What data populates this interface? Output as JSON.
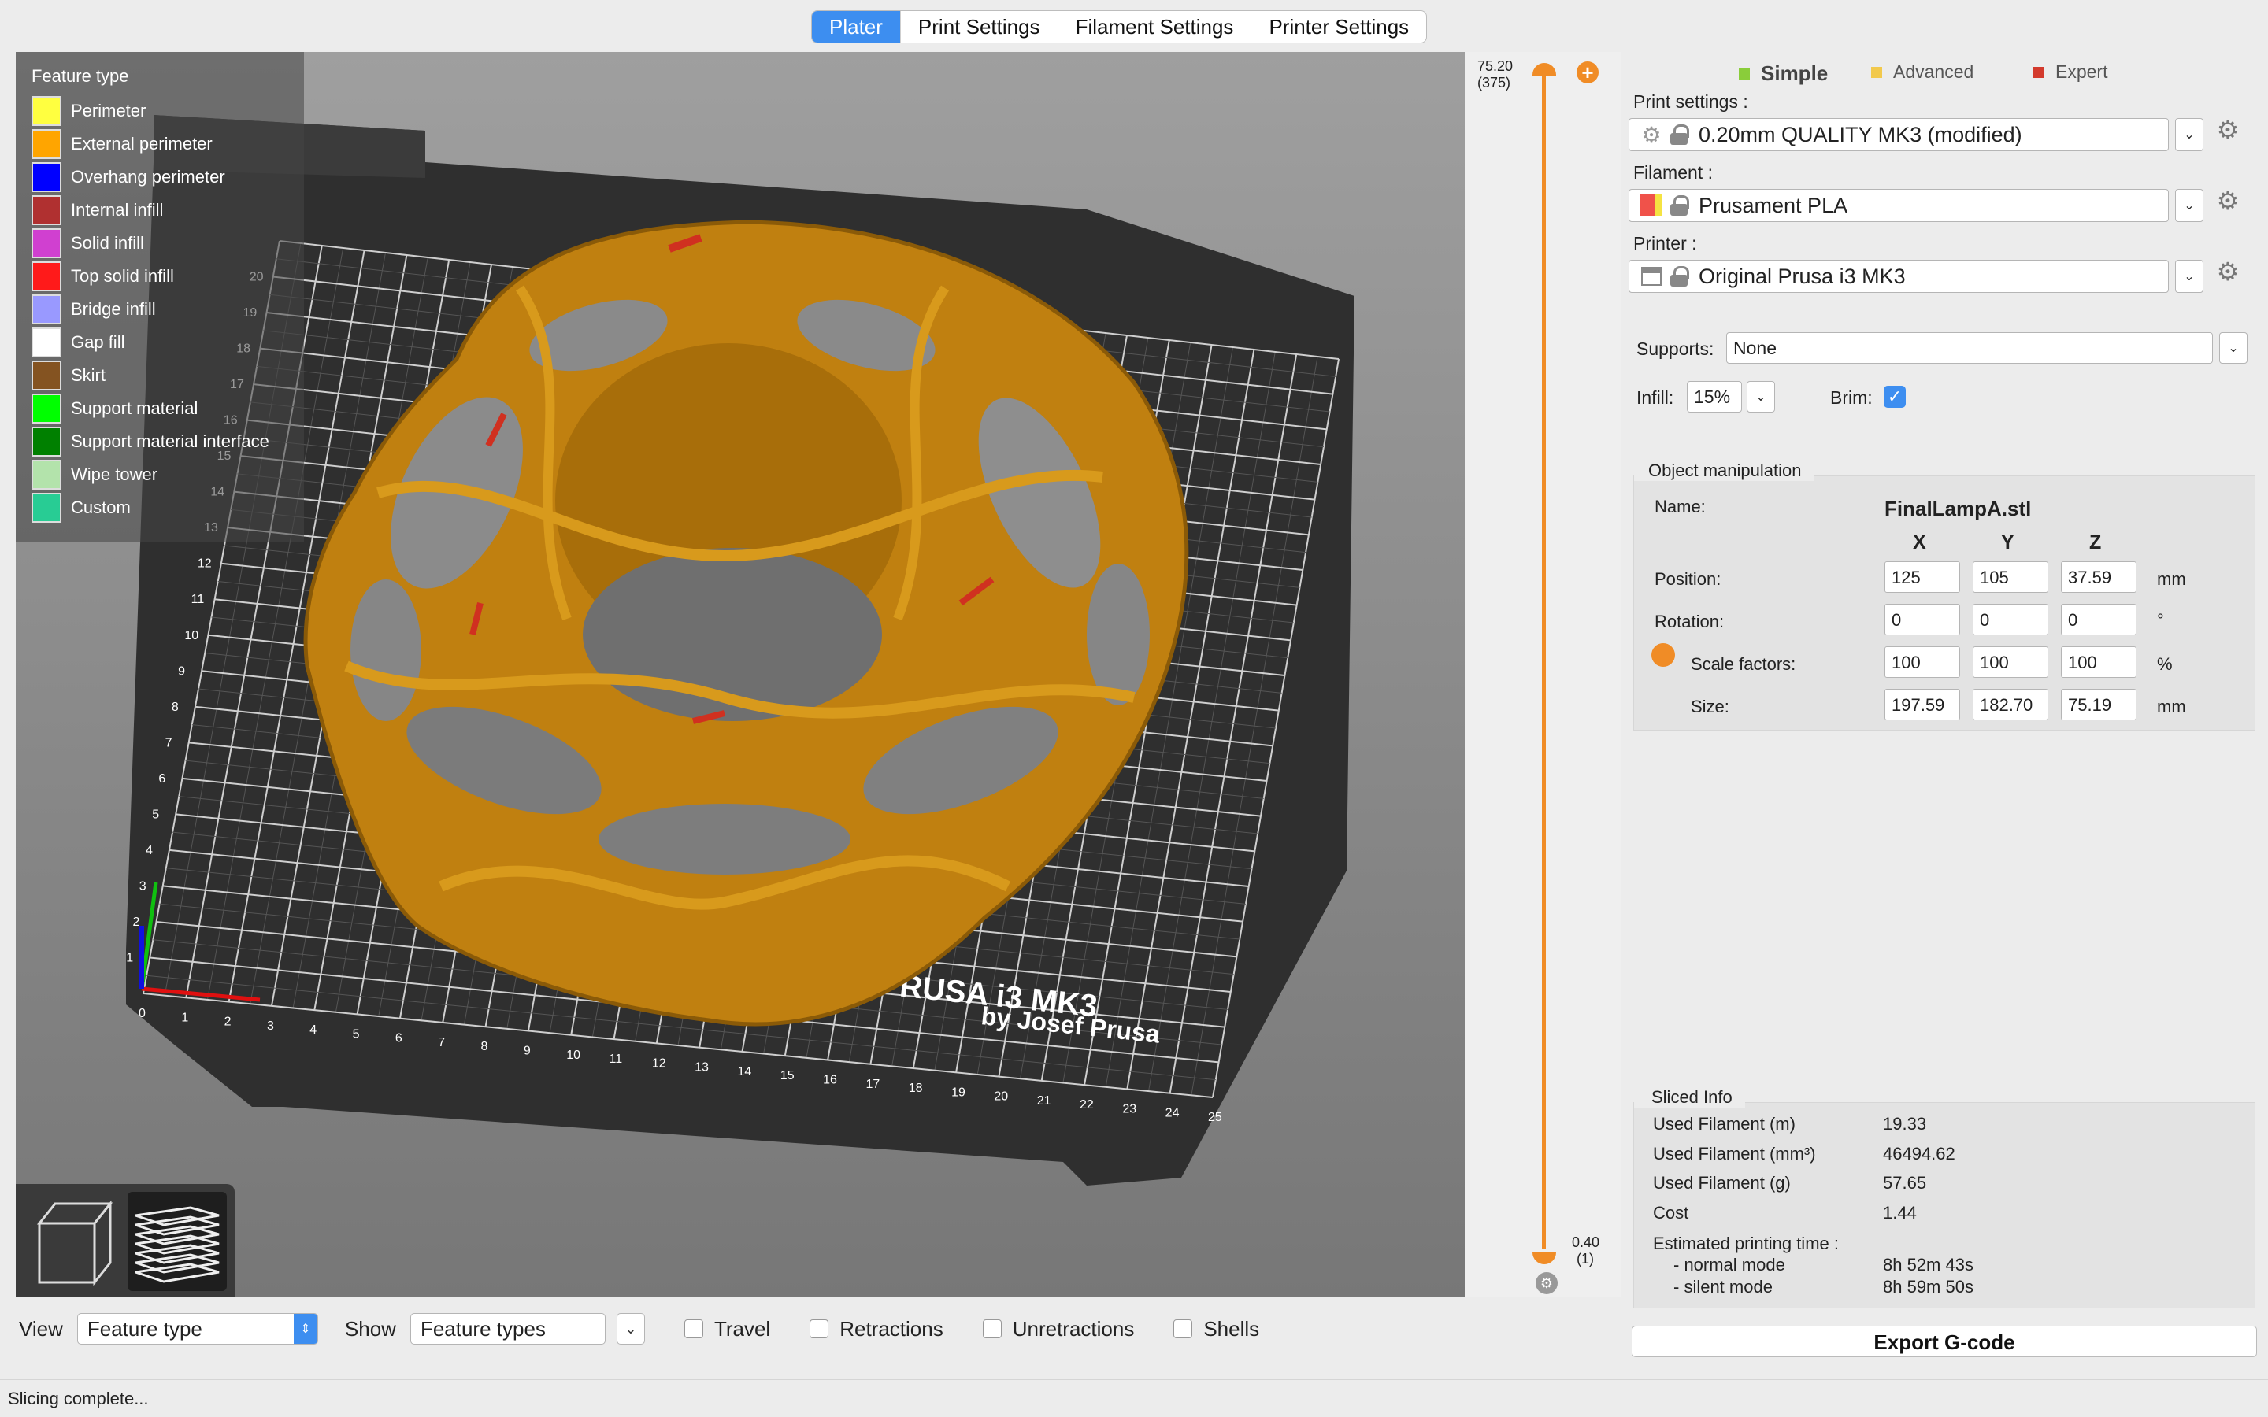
{
  "tabs": [
    "Plater",
    "Print Settings",
    "Filament Settings",
    "Printer Settings"
  ],
  "legend": {
    "title": "Feature type",
    "items": [
      {
        "label": "Perimeter",
        "color": "#FFFF40"
      },
      {
        "label": "External perimeter",
        "color": "#FFA500"
      },
      {
        "label": "Overhang perimeter",
        "color": "#0000FF"
      },
      {
        "label": "Internal infill",
        "color": "#B03030"
      },
      {
        "label": "Solid infill",
        "color": "#D040D0"
      },
      {
        "label": "Top solid infill",
        "color": "#FF1A1A"
      },
      {
        "label": "Bridge infill",
        "color": "#9999FF"
      },
      {
        "label": "Gap fill",
        "color": "#FFFFFF"
      },
      {
        "label": "Skirt",
        "color": "#845321"
      },
      {
        "label": "Support material",
        "color": "#00FF00"
      },
      {
        "label": "Support material interface",
        "color": "#008000"
      },
      {
        "label": "Wipe tower",
        "color": "#B3E3AB"
      },
      {
        "label": "Custom",
        "color": "#28CC94"
      }
    ]
  },
  "bed": {
    "ticks_x": [
      "0",
      "1",
      "2",
      "3",
      "4",
      "5",
      "6",
      "7",
      "8",
      "9",
      "10",
      "11",
      "12",
      "13",
      "14",
      "15",
      "16",
      "17",
      "18",
      "19",
      "20",
      "21",
      "22",
      "23",
      "24",
      "25"
    ],
    "ticks_y": [
      "1",
      "2",
      "3",
      "4",
      "5",
      "6",
      "7",
      "8",
      "9",
      "10",
      "11",
      "12",
      "13",
      "14",
      "15",
      "16",
      "17",
      "18",
      "19",
      "20"
    ],
    "logo_line1": "ORIGINAL PRUSA i3 MK3",
    "logo_line2": "by Josef Prusa"
  },
  "slider": {
    "top_value": "75.20",
    "top_layer": "(375)",
    "bottom_value": "0.40",
    "bottom_layer": "(1)",
    "top_position": 1.0,
    "bottom_position": 0.0
  },
  "bottom": {
    "view_label": "View",
    "view_value": "Feature type",
    "show_label": "Show",
    "show_value": "Feature types",
    "checkboxes": [
      "Travel",
      "Retractions",
      "Unretractions",
      "Shells"
    ]
  },
  "status": "Slicing complete...",
  "panel": {
    "modes": [
      {
        "label": "Simple",
        "color": "#8ACD3A",
        "active": true
      },
      {
        "label": "Advanced",
        "color": "#F2C94C",
        "active": false
      },
      {
        "label": "Expert",
        "color": "#D33A2C",
        "active": false
      }
    ],
    "print_settings_label": "Print settings :",
    "print_settings_value": "0.20mm QUALITY MK3 (modified)",
    "filament_label": "Filament :",
    "filament_value": "Prusament PLA",
    "filament_color": "#F0524A",
    "printer_label": "Printer :",
    "printer_value": "Original Prusa i3 MK3",
    "supports_label": "Supports:",
    "supports_value": "None",
    "infill_label": "Infill:",
    "infill_value": "15%",
    "brim_label": "Brim:",
    "brim_checked": true
  },
  "object": {
    "title": "Object manipulation",
    "name_label": "Name:",
    "name_value": "FinalLampA.stl",
    "axes": [
      "X",
      "Y",
      "Z"
    ],
    "position_label": "Position:",
    "position": [
      "125",
      "105",
      "37.59"
    ],
    "position_unit": "mm",
    "rotation_label": "Rotation:",
    "rotation": [
      "0",
      "0",
      "0"
    ],
    "rotation_unit": "°",
    "scale_label": "Scale factors:",
    "scale": [
      "100",
      "100",
      "100"
    ],
    "scale_unit": "%",
    "size_label": "Size:",
    "size": [
      "197.59",
      "182.70",
      "75.19"
    ],
    "size_unit": "mm"
  },
  "sliced": {
    "title": "Sliced Info",
    "rows": [
      {
        "label": "Used Filament (m)",
        "value": "19.33"
      },
      {
        "label": "Used Filament (mm³)",
        "value": "46494.62"
      },
      {
        "label": "Used Filament (g)",
        "value": "57.65"
      },
      {
        "label": "Cost",
        "value": "1.44"
      }
    ],
    "time_label": "Estimated printing time :",
    "normal_label": "- normal mode",
    "normal_value": "8h 52m 43s",
    "silent_label": "- silent mode",
    "silent_value": "8h 59m 50s"
  },
  "export_label": "Export G-code"
}
